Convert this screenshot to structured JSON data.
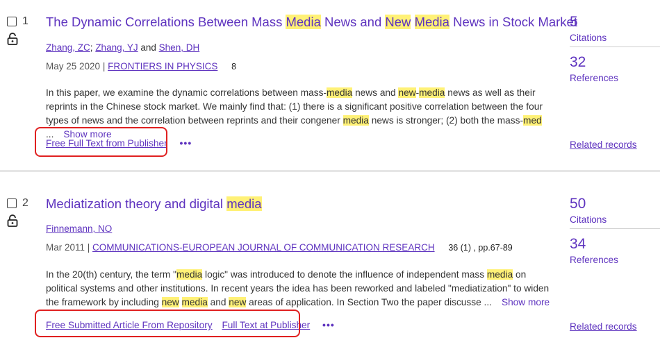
{
  "records": [
    {
      "number": "1",
      "title_parts": [
        {
          "t": "The Dynamic Correlations Between Mass ",
          "hl": false
        },
        {
          "t": "Media",
          "hl": true
        },
        {
          "t": " News and ",
          "hl": false
        },
        {
          "t": "New",
          "hl": true
        },
        {
          "t": " ",
          "hl": false
        },
        {
          "t": "Media",
          "hl": true
        },
        {
          "t": " News in Stock Market",
          "hl": false
        }
      ],
      "authors": [
        "Zhang, ZC",
        "Zhang, YJ",
        "Shen, DH"
      ],
      "author_sep": ";",
      "author_and": "and",
      "date": "May 25 2020",
      "journal": "FRONTIERS IN PHYSICS",
      "volume": "8",
      "abstract_parts": [
        {
          "t": "In this paper, we examine the dynamic correlations between mass-",
          "hl": false
        },
        {
          "t": "media",
          "hl": true
        },
        {
          "t": " news and ",
          "hl": false
        },
        {
          "t": "new",
          "hl": true
        },
        {
          "t": "-",
          "hl": false
        },
        {
          "t": "media",
          "hl": true
        },
        {
          "t": " news as well as their reprints in the Chinese stock market. We mainly find that: (1) there is a significant positive correlation between the four types of news and the correlation between reprints and their congener ",
          "hl": false
        },
        {
          "t": "media",
          "hl": true
        },
        {
          "t": " news is stronger; (2) both the mass-",
          "hl": false
        },
        {
          "t": "med",
          "hl": true
        },
        {
          "t": " ...",
          "hl": false
        }
      ],
      "show_more": "Show more",
      "links": [
        "Free Full Text from Publisher"
      ],
      "citations": {
        "count": "5",
        "label": "Citations"
      },
      "references": {
        "count": "32",
        "label": "References"
      },
      "related": "Related records"
    },
    {
      "number": "2",
      "title_parts": [
        {
          "t": "Mediatization theory and digital ",
          "hl": false
        },
        {
          "t": "media",
          "hl": true
        }
      ],
      "authors": [
        "Finnemann, NO"
      ],
      "author_sep": "",
      "author_and": "",
      "date": "Mar 2011",
      "journal": "COMMUNICATIONS-EUROPEAN JOURNAL OF COMMUNICATION RESEARCH",
      "volume": "36 (1) , pp.67-89",
      "abstract_parts": [
        {
          "t": "In the 20(th) century, the term \"",
          "hl": false
        },
        {
          "t": "media",
          "hl": true
        },
        {
          "t": " logic\" was introduced to denote the influence of independent mass ",
          "hl": false
        },
        {
          "t": "media",
          "hl": true
        },
        {
          "t": " on political systems and other institutions. In recent years the idea has been reworked and labeled \"mediatization\" to widen the framework by including ",
          "hl": false
        },
        {
          "t": "new",
          "hl": true
        },
        {
          "t": " ",
          "hl": false
        },
        {
          "t": "media",
          "hl": true
        },
        {
          "t": " and ",
          "hl": false
        },
        {
          "t": "new",
          "hl": true
        },
        {
          "t": " areas of application. In Section Two the paper discusse ...",
          "hl": false
        }
      ],
      "show_more": "Show more",
      "links": [
        "Free Submitted Article From Repository",
        "Full Text at Publisher"
      ],
      "citations": {
        "count": "50",
        "label": "Citations"
      },
      "references": {
        "count": "34",
        "label": "References"
      },
      "related": "Related records"
    }
  ],
  "colors": {
    "link": "#5e33bf",
    "highlight": "#fff176",
    "callout": "#e02020"
  },
  "icons": {
    "lock": "unlocked-padlock-icon",
    "more": "more-options-icon"
  }
}
